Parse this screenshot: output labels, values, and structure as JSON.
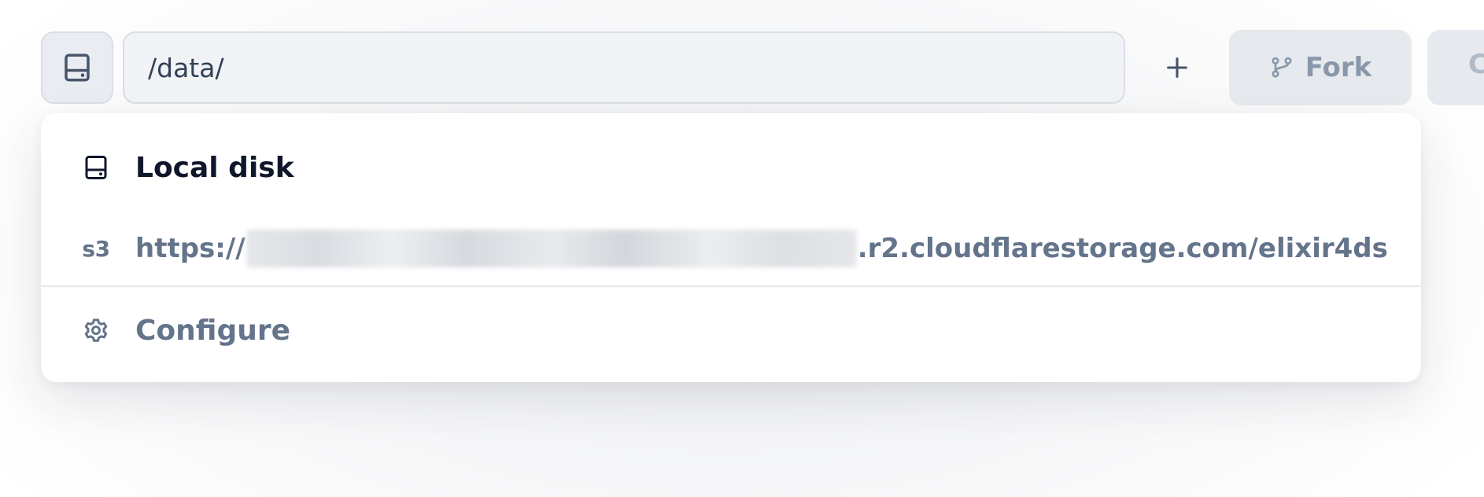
{
  "toolbar": {
    "disk_toggle_icon": "hard-drive-icon",
    "path_value": "/data/",
    "add_icon": "plus-icon",
    "fork": {
      "icon": "git-fork-icon",
      "label": "Fork"
    },
    "cut_off_button_label": "C"
  },
  "file_system_menu": {
    "items": [
      {
        "icon": "hard-drive-icon",
        "label": "Local disk"
      },
      {
        "icon_text": "s3",
        "url_prefix": "https://",
        "url_suffix": ".r2.cloudflarestorage.com/elixir4ds",
        "redacted": true
      }
    ],
    "configure": {
      "icon": "gear-icon",
      "label": "Configure"
    }
  },
  "colors": {
    "muted_text": "#64748b",
    "primary_text": "#0f172a",
    "button_bg": "#e6e9ee"
  }
}
